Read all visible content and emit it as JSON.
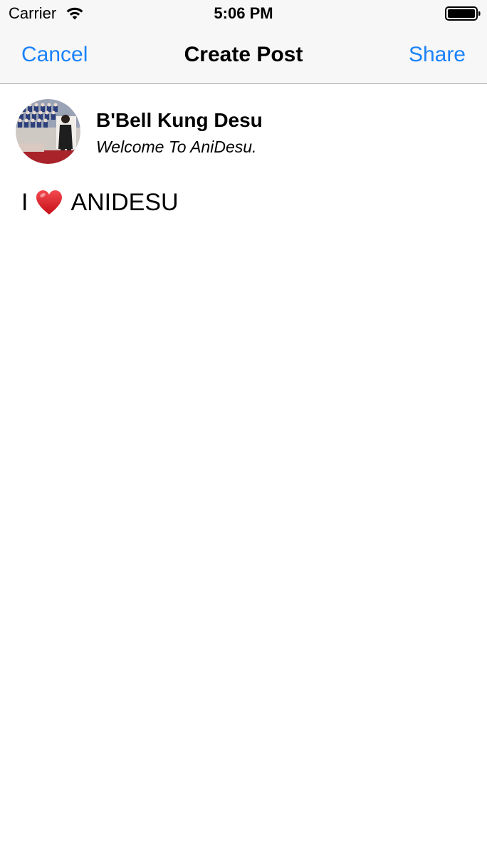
{
  "status_bar": {
    "carrier": "Carrier",
    "time": "5:06 PM",
    "wifi_icon": "wifi-icon",
    "battery_icon": "battery-icon"
  },
  "nav": {
    "cancel_label": "Cancel",
    "title": "Create Post",
    "share_label": "Share",
    "accent_color": "#1a82fb"
  },
  "post_header": {
    "user_name": "B'Bell Kung Desu",
    "subtitle": "Welcome To AniDesu.",
    "avatar_icon": "avatar"
  },
  "post_body": {
    "text_before": "I",
    "emoji": "heart-icon",
    "text_after": "ANIDESU",
    "heart_color": "#e0141e"
  }
}
